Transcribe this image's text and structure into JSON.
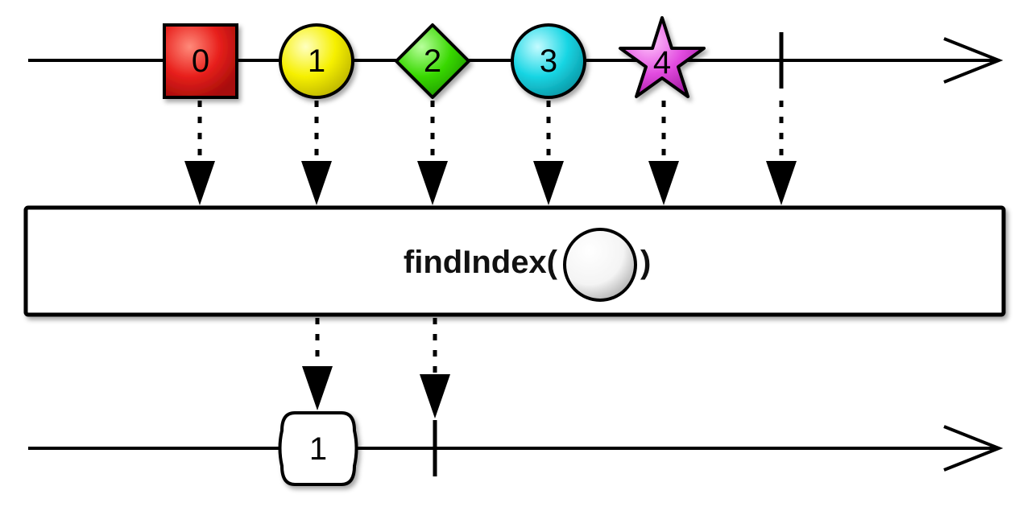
{
  "operator": {
    "name_prefix": "findIndex(",
    "name_suffix": ")"
  },
  "input": {
    "marbles": [
      {
        "label": "0",
        "shape": "square",
        "color": "#e8201c"
      },
      {
        "label": "1",
        "shape": "circle",
        "color": "#f6f000"
      },
      {
        "label": "2",
        "shape": "diamond",
        "color": "#38d800"
      },
      {
        "label": "3",
        "shape": "circle",
        "color": "#19d6e4"
      },
      {
        "label": "4",
        "shape": "star",
        "color": "#e24ce0"
      }
    ],
    "completes": true
  },
  "output": {
    "marbles": [
      {
        "label": "1",
        "shape": "rounded-box",
        "color": "#ffffff"
      }
    ],
    "completes": true
  },
  "predicate": {
    "shape": "circle",
    "color": "#ffffff"
  }
}
